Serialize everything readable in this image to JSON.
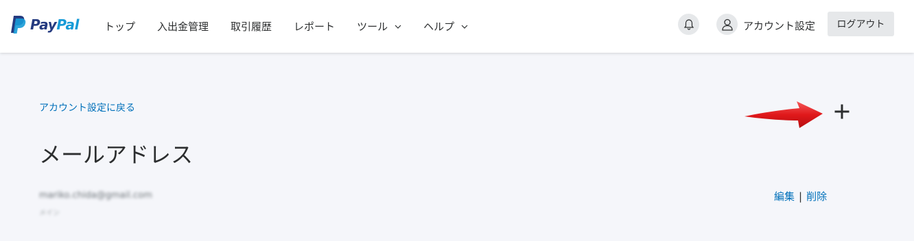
{
  "header": {
    "logo_text_pay": "Pay",
    "logo_text_pal": "Pal",
    "nav": [
      {
        "label": "トップ"
      },
      {
        "label": "入出金管理"
      },
      {
        "label": "取引履歴"
      },
      {
        "label": "レポート"
      },
      {
        "label": "ツール"
      },
      {
        "label": "ヘルプ"
      }
    ],
    "account_settings_label": "アカウント設定",
    "logout_label": "ログアウト"
  },
  "main": {
    "back_link": "アカウント設定に戻る",
    "title": "メールアドレス",
    "add_label": "+",
    "email": {
      "address": "mariko.chida@gmail.com",
      "status": "メイン"
    },
    "actions": {
      "edit_label": "編集",
      "separator": "|",
      "delete_label": "削除"
    }
  },
  "colors": {
    "link": "#0070ba",
    "logo_dark": "#253b80",
    "logo_light": "#179bd7",
    "annotation_arrow": "#e0191b"
  },
  "icons": [
    "paypal-logo-icon",
    "chevron-down-icon",
    "bell-icon",
    "user-icon",
    "plus-icon",
    "red-arrow-annotation"
  ]
}
